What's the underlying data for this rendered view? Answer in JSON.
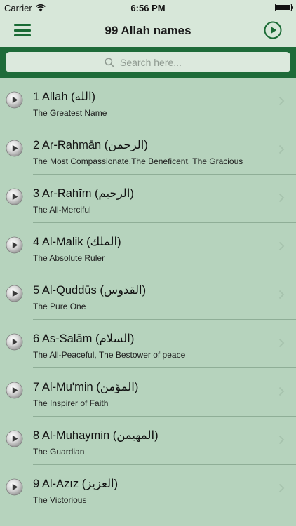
{
  "status_bar": {
    "carrier": "Carrier",
    "time": "6:56 PM"
  },
  "nav": {
    "title": "99 Allah names",
    "menu_icon": "hamburger-menu-icon",
    "play_icon": "play-circle-icon"
  },
  "search": {
    "placeholder": "Search here...",
    "value": ""
  },
  "colors": {
    "accent": "#1e6b39",
    "header_bg": "#d7e7d9",
    "list_bg": "#b6d3bd"
  },
  "items": [
    {
      "title": "1 Allah (الله)",
      "subtitle": "The Greatest Name"
    },
    {
      "title": "2 Ar-Rahmān (الرحمن)",
      "subtitle": "The Most Compassionate,The Beneficent, The Gracious"
    },
    {
      "title": "3 Ar-Rahīm (الرحيم)",
      "subtitle": "The All-Merciful"
    },
    {
      "title": "4 Al-Malik (الملك)",
      "subtitle": "The Absolute Ruler"
    },
    {
      "title": "5 Al-Quddūs (القدوس)",
      "subtitle": "The Pure One"
    },
    {
      "title": "6 As-Salām (السلام)",
      "subtitle": "The All-Peaceful, The Bestower of peace"
    },
    {
      "title": "7 Al-Mu'min (المؤمن)",
      "subtitle": "The Inspirer of Faith"
    },
    {
      "title": "8 Al-Muhaymin (المهيمن)",
      "subtitle": "The Guardian"
    },
    {
      "title": "9 Al-Azīz (العزيز)",
      "subtitle": "The Victorious"
    }
  ]
}
